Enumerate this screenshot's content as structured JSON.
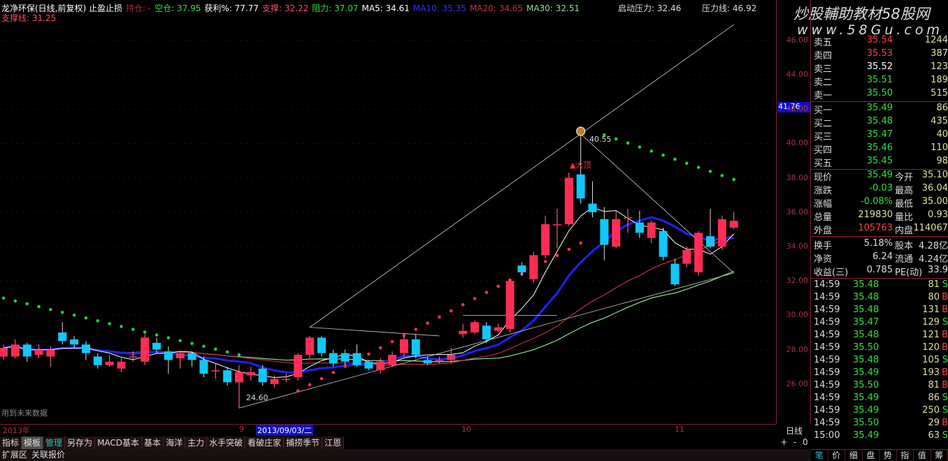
{
  "header": {
    "title": "龙净环保(日线,前复权) 止盈止损",
    "hold": "持仓: -",
    "empty": "空仓: 37.95",
    "profit": "获利%: 77.77",
    "support": "支撑: 32.22",
    "resist": "阻力: 37.07",
    "ma5": "MA5: 34.61",
    "ma10": "MA10: 35.35",
    "ma20": "MA20: 34.65",
    "ma30": "MA30: 32.51",
    "support_line": "支撑线: 31.25",
    "start_pressure": "启动压力: 32.46",
    "pressure_line": "压力线: 46.92"
  },
  "watermark": {
    "line1": "炒股輔助教材58股网",
    "line2": "www.58Gu.com"
  },
  "axis": {
    "ticks": [
      "46.00",
      "44.00",
      "42.00",
      "40.00",
      "38.00",
      "36.00",
      "34.00",
      "32.00",
      "30.00",
      "28.00",
      "26.00"
    ],
    "cursor": "41.76"
  },
  "annotations": {
    "high": "40.55",
    "low": "24.60",
    "top_label": "▲大顶",
    "future_note": "用到未来数据"
  },
  "colors": {
    "up": "#ff2d55",
    "down": "#10c8ff",
    "ma5": "#ffffff",
    "ma10": "#2020ff",
    "ma20": "#c03040",
    "ma30": "#90e090",
    "sar_up": "#ff3050",
    "sar_down": "#20d040"
  },
  "chart_data": {
    "type": "candlestick",
    "ylim": [
      24,
      47
    ],
    "candles": [
      [
        27.6,
        28.1,
        28.3,
        27.4
      ],
      [
        27.6,
        28.3,
        28.6,
        27.5
      ],
      [
        28.3,
        27.6,
        28.4,
        27.3
      ],
      [
        27.7,
        28.0,
        28.3,
        27.5
      ],
      [
        27.6,
        28.0,
        28.2,
        27.0
      ],
      [
        29.0,
        28.5,
        29.6,
        28.3
      ],
      [
        28.6,
        28.3,
        28.8,
        28.1
      ],
      [
        28.3,
        27.8,
        28.5,
        27.4
      ],
      [
        27.6,
        27.1,
        27.8,
        26.9
      ],
      [
        27.1,
        27.3,
        27.7,
        27.0
      ],
      [
        26.9,
        27.3,
        27.5,
        26.7
      ],
      [
        27.6,
        27.6,
        27.9,
        27.3
      ],
      [
        27.3,
        28.7,
        28.9,
        27.1
      ],
      [
        28.4,
        28.0,
        28.7,
        27.8
      ],
      [
        27.9,
        27.4,
        28.2,
        26.6
      ],
      [
        27.5,
        27.8,
        27.9,
        26.9
      ],
      [
        27.8,
        27.4,
        27.9,
        27.0
      ],
      [
        27.4,
        26.6,
        27.6,
        26.4
      ],
      [
        26.8,
        26.8,
        27.2,
        26.3
      ],
      [
        26.8,
        26.1,
        27.0,
        25.9
      ],
      [
        26.1,
        26.7,
        27.1,
        24.6
      ],
      [
        26.5,
        26.7,
        27.0,
        26.2
      ],
      [
        26.9,
        26.1,
        27.1,
        25.9
      ],
      [
        26.0,
        26.3,
        26.5,
        25.8
      ],
      [
        26.3,
        26.3,
        26.6,
        26.1
      ],
      [
        26.4,
        27.7,
        27.8,
        26.2
      ],
      [
        27.7,
        28.7,
        28.8,
        27.5
      ],
      [
        28.7,
        27.8,
        28.8,
        27.6
      ],
      [
        27.8,
        27.2,
        28.0,
        27.0
      ],
      [
        27.8,
        27.3,
        28.0,
        27.1
      ],
      [
        27.8,
        27.1,
        28.3,
        27.0
      ],
      [
        27.3,
        26.9,
        27.4,
        26.8
      ],
      [
        26.8,
        27.3,
        27.5,
        26.6
      ],
      [
        27.1,
        27.7,
        27.9,
        27.0
      ],
      [
        27.8,
        28.6,
        28.8,
        27.6
      ],
      [
        28.6,
        27.7,
        28.9,
        27.5
      ],
      [
        27.4,
        27.2,
        27.6,
        27.1
      ],
      [
        27.4,
        27.4,
        27.6,
        27.2
      ],
      [
        27.4,
        27.7,
        28.1,
        27.2
      ],
      [
        28.9,
        29.1,
        29.5,
        28.7
      ],
      [
        29.0,
        29.6,
        29.7,
        28.9
      ],
      [
        29.4,
        28.6,
        29.6,
        28.4
      ],
      [
        29.1,
        29.3,
        29.5,
        29.0
      ],
      [
        29.2,
        32.0,
        32.1,
        29.0
      ],
      [
        32.9,
        32.5,
        33.1,
        32.3
      ],
      [
        32.1,
        33.5,
        33.7,
        31.9
      ],
      [
        33.5,
        35.3,
        35.8,
        33.3
      ],
      [
        35.3,
        35.3,
        36.2,
        33.9
      ],
      [
        35.3,
        38.0,
        38.3,
        35.2
      ],
      [
        38.2,
        36.8,
        40.5,
        36.5
      ],
      [
        36.5,
        36.0,
        37.8,
        35.7
      ],
      [
        35.6,
        34.1,
        36.3,
        33.2
      ],
      [
        34.0,
        35.6,
        36.1,
        33.9
      ],
      [
        35.7,
        35.7,
        36.2,
        34.8
      ],
      [
        35.4,
        34.8,
        36.1,
        34.5
      ],
      [
        34.5,
        35.4,
        35.5,
        34.2
      ],
      [
        34.9,
        33.4,
        35.1,
        33.2
      ],
      [
        33.0,
        31.8,
        33.3,
        31.7
      ],
      [
        33.0,
        33.8,
        34.0,
        32.8
      ],
      [
        32.5,
        34.8,
        34.9,
        32.3
      ],
      [
        34.6,
        34.0,
        36.2,
        33.9
      ],
      [
        34.0,
        35.6,
        35.8,
        33.8
      ],
      [
        35.1,
        35.5,
        36.0,
        35.0
      ]
    ],
    "sar": [
      {
        "from": 0,
        "to": 20,
        "start": 31.0,
        "end": 27.7,
        "color": "down"
      },
      {
        "from": 25,
        "to": 49,
        "start": 25.6,
        "end": 34.2,
        "color": "up"
      },
      {
        "from": 51,
        "to": 62,
        "start": 40.5,
        "end": 37.9,
        "color": "down"
      }
    ]
  },
  "orderbook": {
    "sell": [
      {
        "label": "卖五",
        "price": "35.54",
        "vol": "1244"
      },
      {
        "label": "卖四",
        "price": "35.53",
        "vol": "387"
      },
      {
        "label": "卖三",
        "price": "35.52",
        "vol": "123"
      },
      {
        "label": "卖二",
        "price": "35.51",
        "vol": "189"
      },
      {
        "label": "卖一",
        "price": "35.50",
        "vol": "515"
      }
    ],
    "buy": [
      {
        "label": "买一",
        "price": "35.49",
        "vol": "86"
      },
      {
        "label": "买二",
        "price": "35.48",
        "vol": "435"
      },
      {
        "label": "买三",
        "price": "35.47",
        "vol": "40"
      },
      {
        "label": "买四",
        "price": "35.46",
        "vol": "110"
      },
      {
        "label": "买五",
        "price": "35.45",
        "vol": "98"
      }
    ]
  },
  "quote": [
    {
      "l1": "现价",
      "v1": "35.49",
      "l2": "今开",
      "v2": "35.10"
    },
    {
      "l1": "涨跌",
      "v1": "-0.03",
      "l2": "最高",
      "v2": "36.04"
    },
    {
      "l1": "涨幅",
      "v1": "-0.08%",
      "l2": "最低",
      "v2": "35.00"
    },
    {
      "l1": "总量",
      "v1": "219830",
      "l2": "量比",
      "v2": "0.93"
    },
    {
      "l1": "外盘",
      "v1": "105763",
      "l2": "内盘",
      "v2": "114067"
    }
  ],
  "stats": [
    {
      "l1": "换手",
      "v1": "5.18%",
      "l2": "股本",
      "v2": "4.28亿"
    },
    {
      "l1": "净资",
      "v1": "6.24",
      "l2": "流通",
      "v2": "4.24亿"
    },
    {
      "l1": "收益(三)",
      "v1": "0.785",
      "l2": "PE(动)",
      "v2": "33.9"
    }
  ],
  "ticks": [
    [
      "14:59",
      "35.48",
      "81",
      "S"
    ],
    [
      "14:59",
      "35.48",
      "80",
      "B"
    ],
    [
      "14:59",
      "35.48",
      "131",
      "B"
    ],
    [
      "14:59",
      "35.47",
      "129",
      "S"
    ],
    [
      "14:59",
      "35.48",
      "121",
      "B"
    ],
    [
      "14:59",
      "35.50",
      "120",
      "B"
    ],
    [
      "14:59",
      "35.48",
      "105",
      "S"
    ],
    [
      "14:59",
      "35.49",
      "193",
      "B"
    ],
    [
      "14:59",
      "35.50",
      "81",
      "B"
    ],
    [
      "14:59",
      "35.49",
      "86",
      "S"
    ],
    [
      "14:59",
      "35.49",
      "250",
      "S"
    ],
    [
      "14:59",
      "35.50",
      "29",
      "B"
    ],
    [
      "15:00",
      "35.49",
      "63",
      "S"
    ]
  ],
  "dates": {
    "year": "2013年",
    "sep": "9",
    "cursor": "2013/09/03/二",
    "oct": "10",
    "nov": "11"
  },
  "period": "日线",
  "zoom": [
    "+",
    "-",
    "0"
  ],
  "tabs": [
    "指标",
    "模板",
    "管理",
    "另存为",
    "MACD基本",
    "基本",
    "海洋",
    "主力",
    "水手突破",
    "看破庄家",
    "捕捞季节",
    "江恩"
  ],
  "tabs2": [
    "扩展区",
    "关联报价"
  ],
  "panel_tabs": [
    "笔",
    "价",
    "细",
    "盘",
    "势",
    "指",
    "值",
    "筹"
  ]
}
